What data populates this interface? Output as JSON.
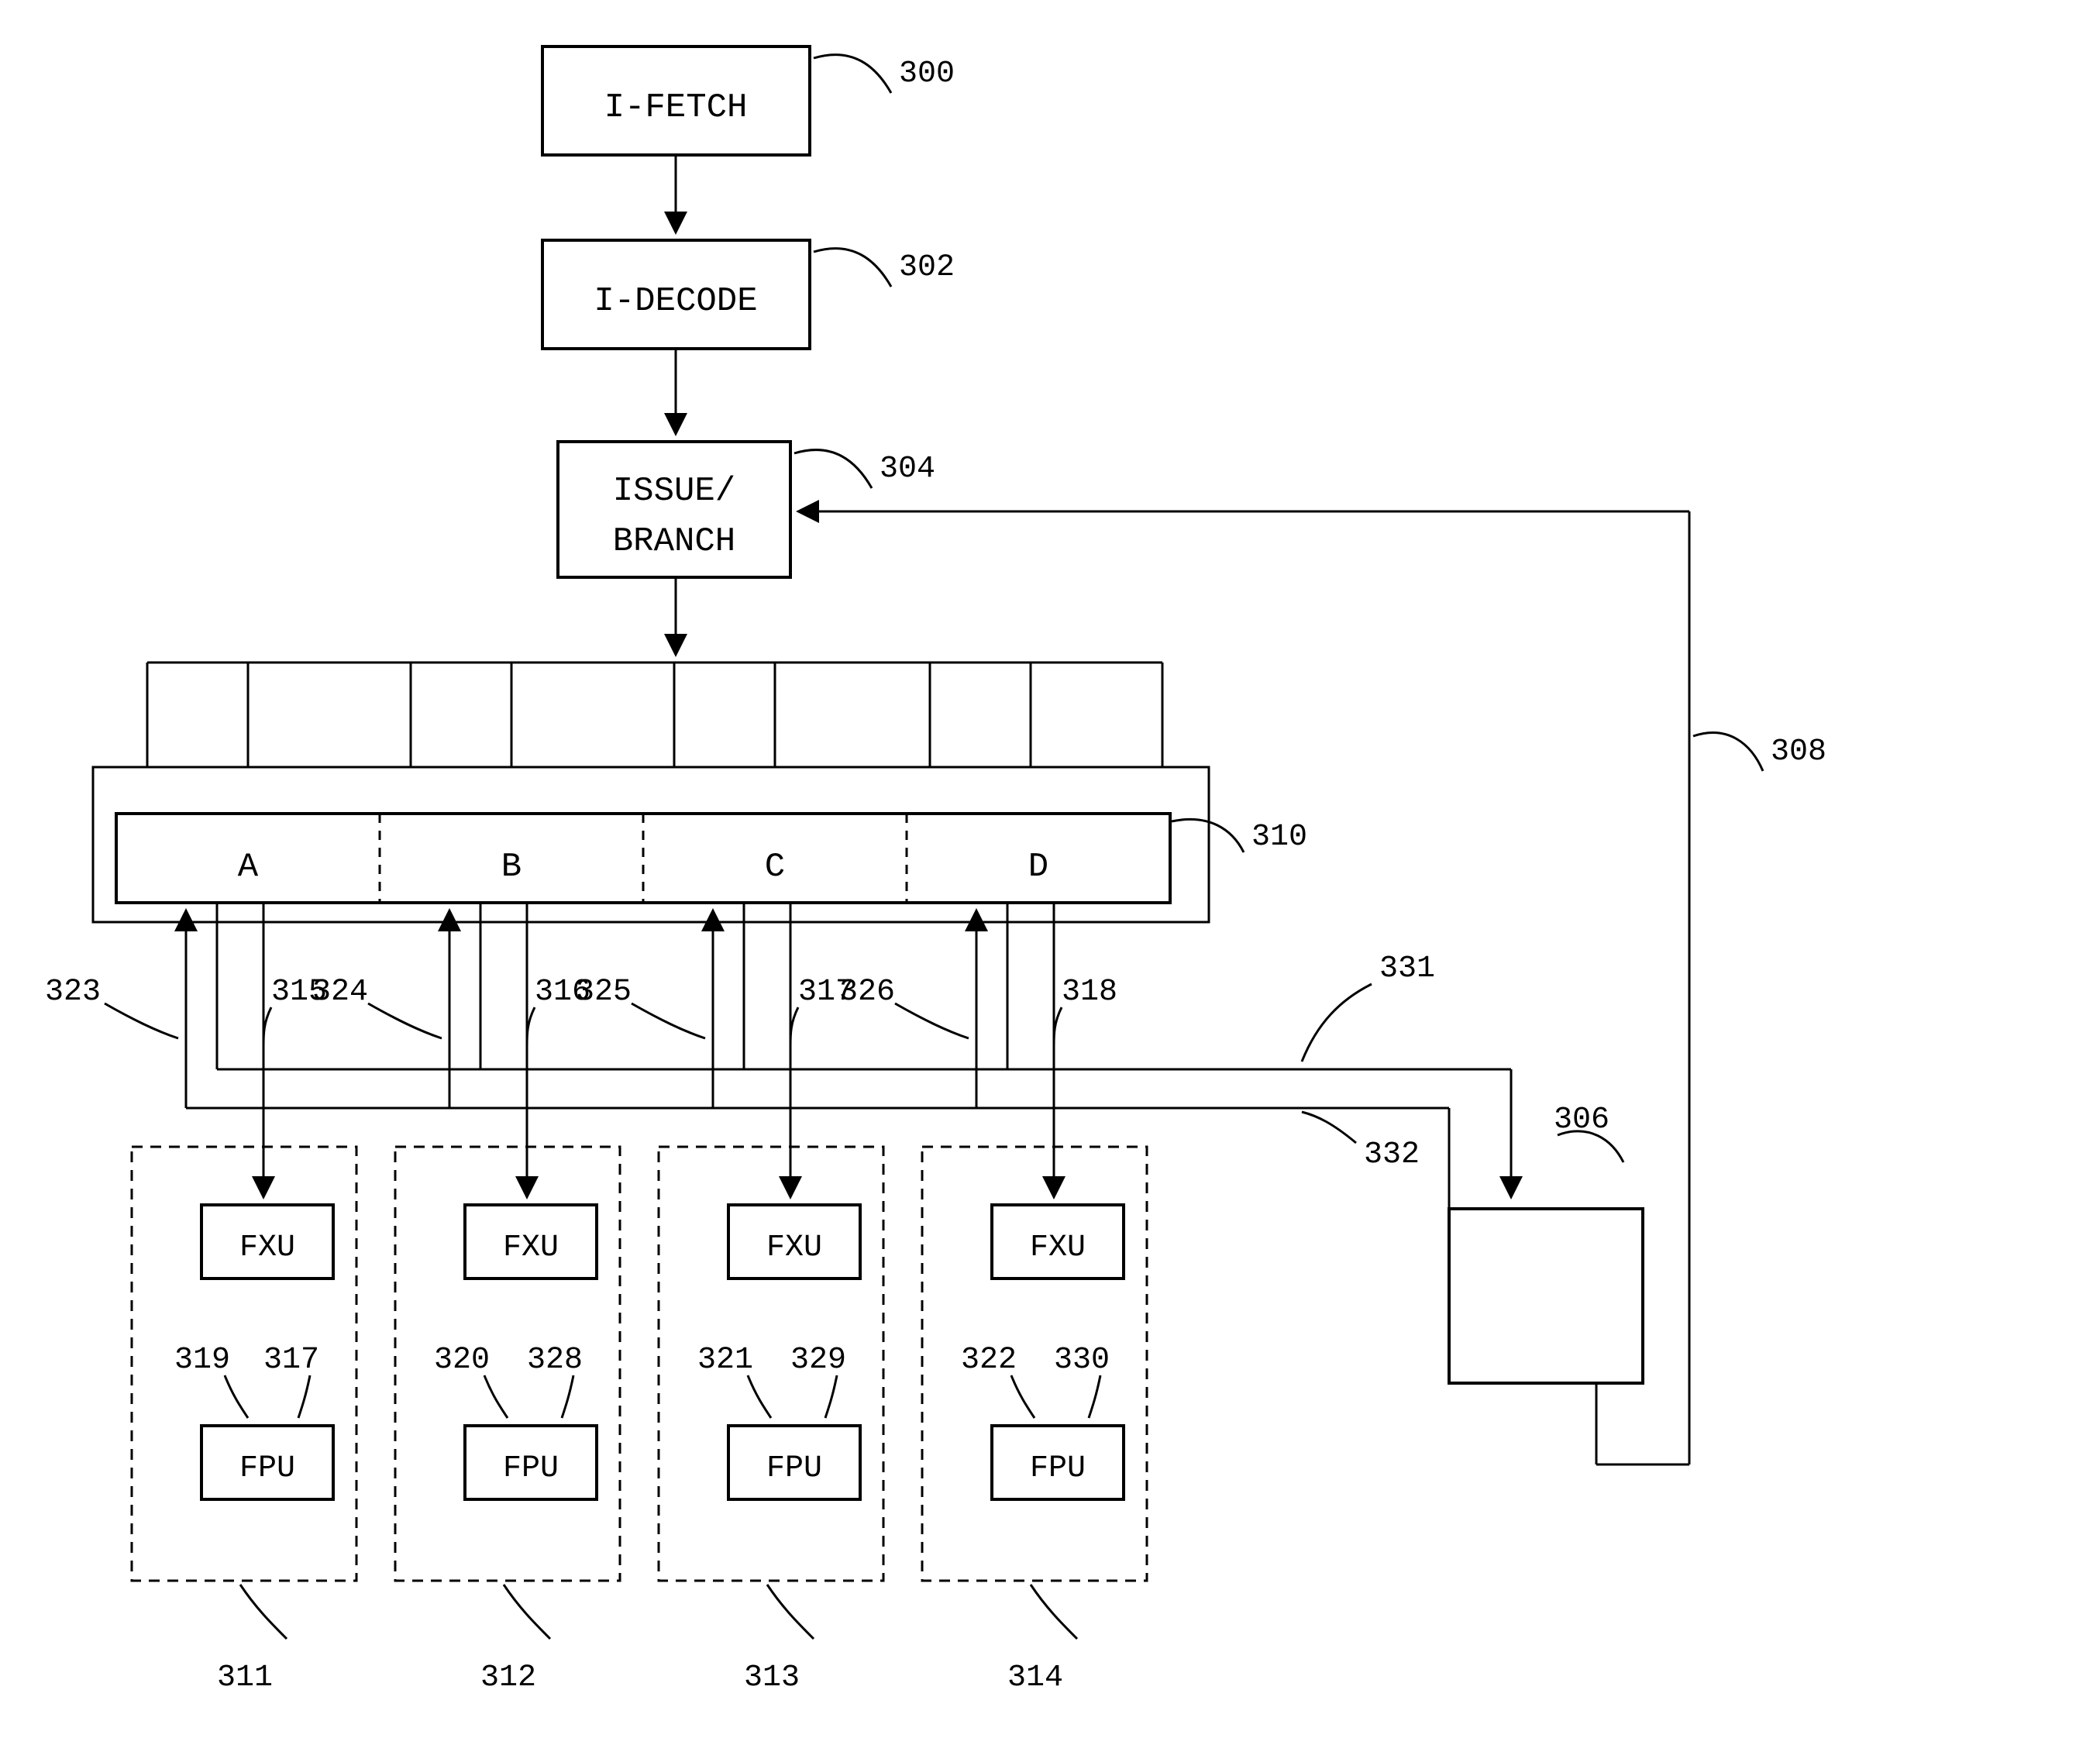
{
  "blocks": {
    "ifetch": {
      "label": "I-FETCH",
      "ref": "300"
    },
    "idecode": {
      "label": "I-DECODE",
      "ref": "302"
    },
    "issue": {
      "line1": "ISSUE/",
      "line2": "BRANCH",
      "ref": "304"
    }
  },
  "register_file": {
    "ref": "310",
    "slots": [
      "A",
      "B",
      "C",
      "D"
    ]
  },
  "loadstore": {
    "ref": "306"
  },
  "feedback": {
    "ref": "308"
  },
  "lanes": [
    {
      "fxu": "FXU",
      "fpu": "FPU",
      "down_ref": "315",
      "up_ref": "323",
      "fxu_ref": "319",
      "fpu_ref": "317",
      "group_ref": "311"
    },
    {
      "fxu": "FXU",
      "fpu": "FPU",
      "down_ref": "316",
      "up_ref": "324",
      "fxu_ref": "320",
      "fpu_ref": "328",
      "group_ref": "312"
    },
    {
      "fxu": "FXU",
      "fpu": "FPU",
      "down_ref": "317",
      "up_ref": "325",
      "fxu_ref": "321",
      "fpu_ref": "329",
      "group_ref": "313"
    },
    {
      "fxu": "FXU",
      "fpu": "FPU",
      "down_ref": "318",
      "up_ref": "326",
      "fxu_ref": "322",
      "fpu_ref": "330",
      "group_ref": "314"
    }
  ],
  "buses": {
    "to_ls": "331",
    "from_ls": "332"
  }
}
